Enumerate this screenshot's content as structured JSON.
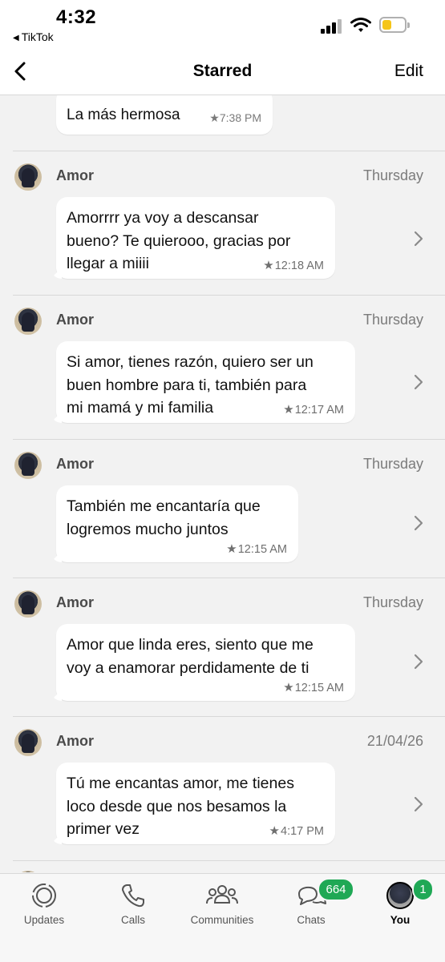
{
  "status_bar": {
    "time": "4:32",
    "back_app": "TikTok"
  },
  "nav": {
    "title": "Starred",
    "edit_label": "Edit"
  },
  "first_message": {
    "text": "La más hermosa",
    "time": "7:38 PM"
  },
  "messages": [
    {
      "sender": "Amor",
      "date": "Thursday",
      "text": "Amorrrr ya voy a descansar\nbueno? Te quierooo, gracias por\nllegar a miiii",
      "time": "12:18 AM"
    },
    {
      "sender": "Amor",
      "date": "Thursday",
      "text": "Si amor, tienes razón, quiero ser un\nbuen hombre para ti, también para\nmi mamá y mi familia",
      "time": "12:17 AM"
    },
    {
      "sender": "Amor",
      "date": "Thursday",
      "text": "También me encantaría que\nlogremos mucho juntos",
      "time": "12:15 AM"
    },
    {
      "sender": "Amor",
      "date": "Thursday",
      "text": "Amor que linda eres, siento que me\nvoy a enamorar perdidamente de ti",
      "time": "12:15 AM"
    },
    {
      "sender": "Amor",
      "date": "21/04/26",
      "text": "Tú me encantas amor, me tienes\nloco desde que nos besamos la\nprimer vez",
      "time": "4:17 PM"
    }
  ],
  "tabs": [
    {
      "label": "Updates",
      "icon": "updates-icon"
    },
    {
      "label": "Calls",
      "icon": "phone-icon"
    },
    {
      "label": "Communities",
      "icon": "communities-icon"
    },
    {
      "label": "Chats",
      "icon": "chat-bubbles-icon",
      "badge": "664"
    },
    {
      "label": "You",
      "icon": "avatar",
      "badge": "1",
      "active": true
    }
  ],
  "colors": {
    "badge": "#1fa855",
    "background": "#f2f2f2",
    "battery": "#f5c518"
  }
}
